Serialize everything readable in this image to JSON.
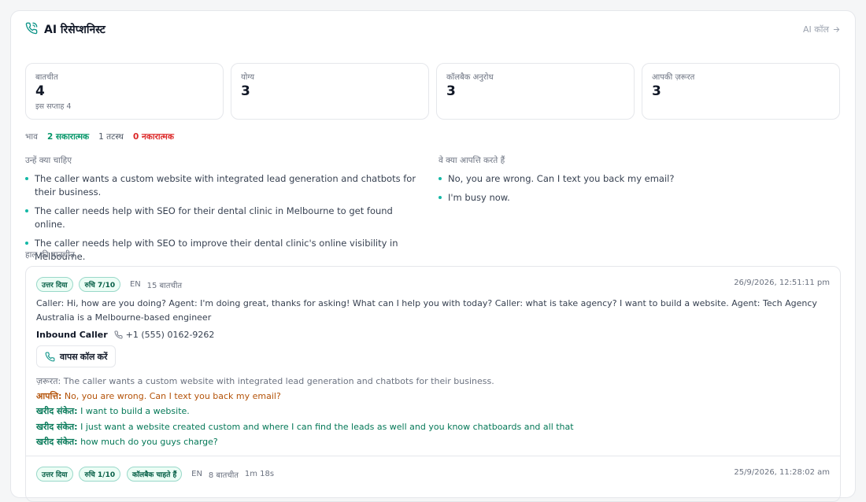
{
  "header": {
    "title": "AI रिसेप्शनिस्ट",
    "link_label": "AI कॉल"
  },
  "stats": [
    {
      "label": "बातचीत",
      "value": "4",
      "sub": "इस सप्ताह 4"
    },
    {
      "label": "योग्य",
      "value": "3",
      "sub": ""
    },
    {
      "label": "कॉलबैक अनुरोध",
      "value": "3",
      "sub": ""
    },
    {
      "label": "आपकी ज़रूरत",
      "value": "3",
      "sub": ""
    }
  ],
  "sentiment": {
    "label": "भाव",
    "positive": "2 सकारात्मक",
    "neutral": "1 तटस्थ",
    "negative": "0 नकारात्मक"
  },
  "wants": {
    "heading": "उन्हें क्या चाहिए",
    "items": [
      "The caller wants a custom website with integrated lead generation and chatbots for their business.",
      "The caller needs help with SEO for their dental clinic in Melbourne to get found online.",
      "The caller needs help with SEO to improve their dental clinic's online visibility in Melbourne."
    ]
  },
  "objections": {
    "heading": "वे क्या आपत्ति करते हैं",
    "items": [
      "No, you are wrong. Can I text you back my email?",
      "I'm busy now."
    ]
  },
  "recent": {
    "heading": "हाल की बातचीत",
    "conversations": [
      {
        "badge_answered": "उत्तर दिया",
        "badge_interest": "रुचि 7/10",
        "lang": "EN",
        "turns": "15 बातचीत",
        "timestamp": "26/9/2026, 12:51:11 pm",
        "transcript": "Caller: Hi, how are you doing? Agent: I'm doing great, thanks for asking! What can I help you with today? Caller: what is take agency? I want to build a website. Agent: Tech Agency Australia is a Melbourne-based engineer",
        "caller_name": "Inbound Caller",
        "caller_phone": "+1 (555) 0162-9262",
        "callback_label": "वापस कॉल करें",
        "need_key": "ज़रूरत:",
        "need_val": "The caller wants a custom website with integrated lead generation and chatbots for their business.",
        "objection_key": "आपत्ति:",
        "objection_val": "No, you are wrong. Can I text you back my email?",
        "buy_key": "खरीद संकेत:",
        "buy_signals": [
          "I want to build a website.",
          "I just want a website created custom and where I can find the leads as well and you know chatboards and all that",
          "how much do you guys charge?"
        ]
      },
      {
        "badge_answered": "उत्तर दिया",
        "badge_interest": "रुचि 1/10",
        "badge_callback": "कॉलबैक चाहते हैं",
        "lang": "EN",
        "turns": "8 बातचीत",
        "duration": "1m 18s",
        "timestamp": "25/9/2026, 11:28:02 am"
      }
    ]
  },
  "colors": {
    "accent": "#14b8a6",
    "positive": "#059669",
    "negative": "#dc2626",
    "objection": "#b45309"
  }
}
